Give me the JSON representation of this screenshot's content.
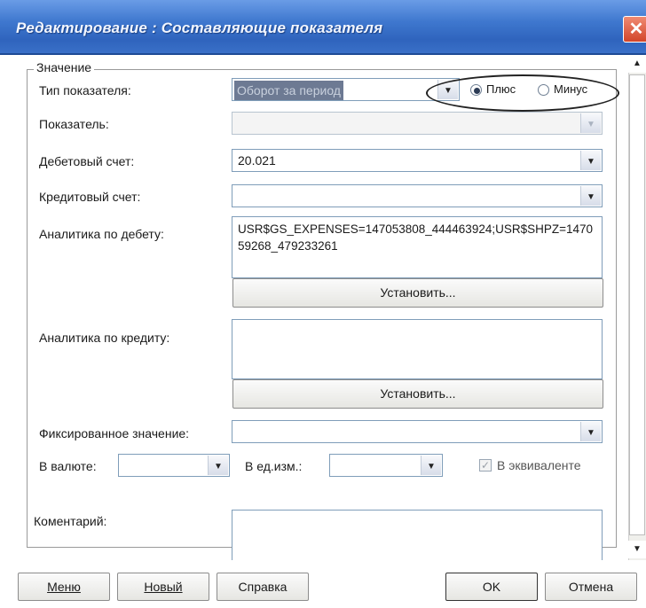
{
  "window": {
    "title": "Редактирование : Составляющие показателя",
    "close_glyph": "✕"
  },
  "group": {
    "legend": "Значение"
  },
  "fields": {
    "indicator_type": {
      "label": "Тип показателя:",
      "value": "Оборот за период"
    },
    "sign": {
      "plus_label": "Плюс",
      "minus_label": "Минус",
      "selected": "Плюс"
    },
    "indicator": {
      "label": "Показатель:",
      "value": ""
    },
    "debit_account": {
      "label": "Дебетовый счет:",
      "value": "20.021"
    },
    "credit_account": {
      "label": "Кредитовый счет:",
      "value": ""
    },
    "debit_analytics": {
      "label": "Аналитика по дебету:",
      "value": "USR$GS_EXPENSES=147053808_444463924;USR$SHPZ=147059268_479233261",
      "button_label": "Установить..."
    },
    "credit_analytics": {
      "label": "Аналитика по кредиту:",
      "value": "",
      "button_label": "Установить..."
    },
    "fixed_value": {
      "label": "Фиксированное значение:",
      "value": ""
    },
    "currency": {
      "label": "В валюте:",
      "value": ""
    },
    "unit": {
      "label": "В ед.изм.:",
      "value": ""
    },
    "equivalent": {
      "label": "В эквиваленте",
      "checked": true
    },
    "comment": {
      "label": "Коментарий:",
      "value": ""
    }
  },
  "footer": {
    "menu_label": "Меню",
    "new_label": "Новый",
    "help_label": "Справка",
    "ok_label": "OK",
    "cancel_label": "Отмена"
  },
  "icons": {
    "dropdown": "▼",
    "scroll_up": "▲",
    "scroll_down": "▼",
    "checkmark": "✓"
  },
  "colors": {
    "title_bar": "#3f78cf",
    "close_button": "#d2452a",
    "selection": "#6d7a93"
  }
}
